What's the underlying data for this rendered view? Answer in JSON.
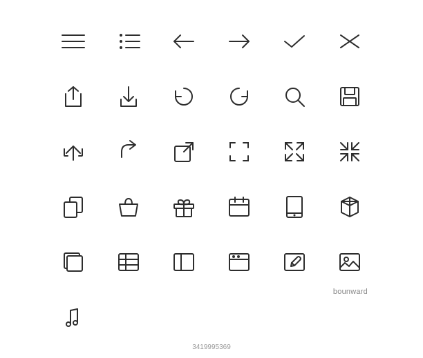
{
  "icons": [
    {
      "name": "hamburger-menu-icon",
      "row": 1,
      "col": 1
    },
    {
      "name": "list-icon",
      "row": 1,
      "col": 2
    },
    {
      "name": "arrow-left-icon",
      "row": 1,
      "col": 3
    },
    {
      "name": "arrow-right-icon",
      "row": 1,
      "col": 4
    },
    {
      "name": "checkmark-icon",
      "row": 1,
      "col": 5
    },
    {
      "name": "close-x-icon",
      "row": 1,
      "col": 6
    },
    {
      "name": "upload-icon",
      "row": 2,
      "col": 1
    },
    {
      "name": "download-icon",
      "row": 2,
      "col": 2
    },
    {
      "name": "refresh-cw-icon",
      "row": 2,
      "col": 3
    },
    {
      "name": "refresh-ccw-icon",
      "row": 2,
      "col": 4
    },
    {
      "name": "search-icon",
      "row": 2,
      "col": 5
    },
    {
      "name": "save-icon",
      "row": 2,
      "col": 6
    },
    {
      "name": "share-icon",
      "row": 3,
      "col": 1
    },
    {
      "name": "external-link-icon",
      "row": 3,
      "col": 2
    },
    {
      "name": "frame-icon",
      "row": 3,
      "col": 3
    },
    {
      "name": "expand-icon",
      "row": 3,
      "col": 4
    },
    {
      "name": "compress-icon",
      "row": 3,
      "col": 5
    },
    {
      "name": "copy-icon",
      "row": 3,
      "col": 6
    },
    {
      "name": "shopping-bag-icon",
      "row": 4,
      "col": 1
    },
    {
      "name": "gift-icon",
      "row": 4,
      "col": 2
    },
    {
      "name": "calendar-icon",
      "row": 4,
      "col": 3
    },
    {
      "name": "tablet-icon",
      "row": 4,
      "col": 4
    },
    {
      "name": "box-3d-icon",
      "row": 4,
      "col": 5
    },
    {
      "name": "layers-icon",
      "row": 4,
      "col": 6
    },
    {
      "name": "table-icon",
      "row": 5,
      "col": 1
    },
    {
      "name": "panel-left-icon",
      "row": 5,
      "col": 2
    },
    {
      "name": "browser-icon",
      "row": 5,
      "col": 3
    },
    {
      "name": "edit-icon",
      "row": 5,
      "col": 4
    },
    {
      "name": "image-icon",
      "row": 5,
      "col": 5
    },
    {
      "name": "music-icon",
      "row": 5,
      "col": 6
    }
  ],
  "watermark": {
    "text": "bounward"
  },
  "getty_id": {
    "text": "3419995369"
  },
  "stroke_color": "#2d2d2d",
  "stroke_width": "1.5"
}
